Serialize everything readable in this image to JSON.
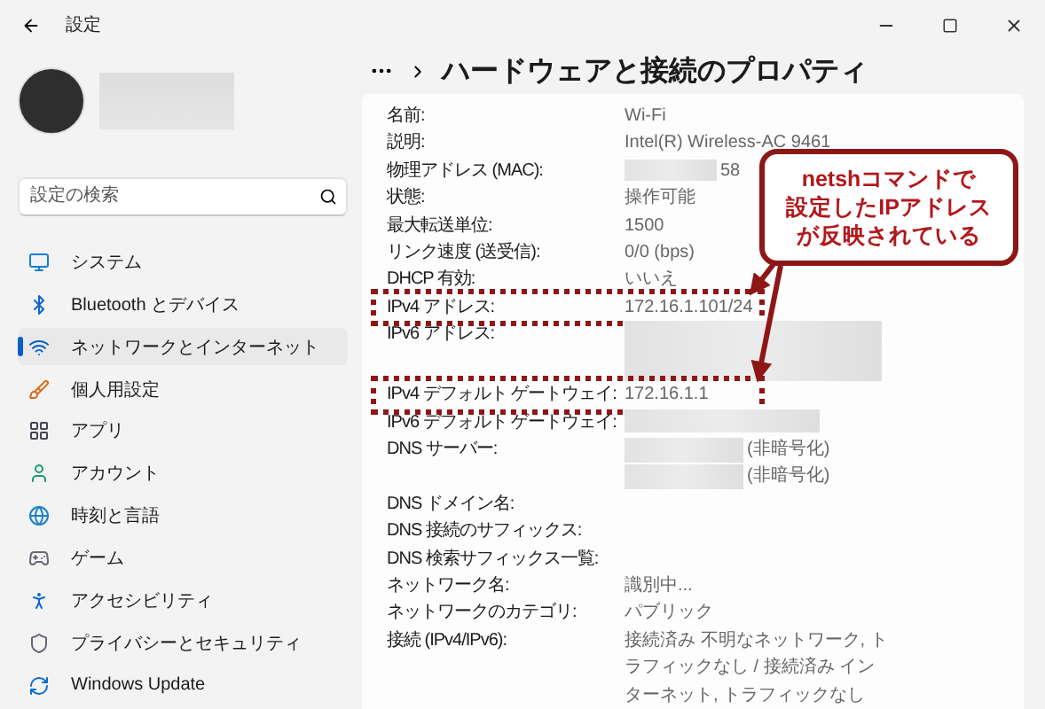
{
  "window": {
    "title": "設定"
  },
  "sidebar": {
    "search": {
      "placeholder": "設定の検索"
    },
    "items": [
      {
        "label": "システム",
        "selected": false
      },
      {
        "label": "Bluetooth とデバイス",
        "selected": false
      },
      {
        "label": "ネットワークとインターネット",
        "selected": true
      },
      {
        "label": "個人用設定",
        "selected": false
      },
      {
        "label": "アプリ",
        "selected": false
      },
      {
        "label": "アカウント",
        "selected": false
      },
      {
        "label": "時刻と言語",
        "selected": false
      },
      {
        "label": "ゲーム",
        "selected": false
      },
      {
        "label": "アクセシビリティ",
        "selected": false
      },
      {
        "label": "プライバシーとセキュリティ",
        "selected": false
      },
      {
        "label": "Windows Update",
        "selected": false
      }
    ]
  },
  "page": {
    "title": "ハードウェアと接続のプロパティ",
    "rows": [
      {
        "label": "名前:",
        "kind": "text",
        "value": "Wi-Fi",
        "highlighted": false
      },
      {
        "label": "説明:",
        "kind": "text",
        "value": "Intel(R) Wireless-AC 9461",
        "highlighted": false
      },
      {
        "label": "物理アドレス (MAC):",
        "kind": "partial",
        "value": "58",
        "highlighted": false
      },
      {
        "label": "状態:",
        "kind": "text",
        "value": "操作可能",
        "highlighted": false
      },
      {
        "label": "最大転送単位:",
        "kind": "text",
        "value": "1500",
        "highlighted": false
      },
      {
        "label": "リンク速度 (送受信):",
        "kind": "text",
        "value": "0/0 (bps)",
        "highlighted": false
      },
      {
        "label": "DHCP 有効:",
        "kind": "text",
        "value": "いいえ",
        "highlighted": false
      },
      {
        "label": "IPv4 アドレス:",
        "kind": "text",
        "value": "172.16.1.101/24",
        "highlighted": true
      },
      {
        "label": "IPv6 アドレス:",
        "kind": "redacted-tall",
        "highlighted": false
      },
      {
        "label": "IPv4 デフォルト ゲートウェイ:",
        "kind": "text",
        "value": "172.16.1.1",
        "highlighted": true
      },
      {
        "label": "IPv6 デフォルト ゲートウェイ:",
        "kind": "redacted",
        "highlighted": false
      },
      {
        "label": "DNS サーバー:",
        "kind": "dns",
        "suffixes": [
          "(非暗号化)",
          "(非暗号化)"
        ],
        "highlighted": false
      },
      {
        "label": "DNS ドメイン名:",
        "kind": "empty",
        "highlighted": false
      },
      {
        "label": "DNS 接続のサフィックス:",
        "kind": "empty",
        "highlighted": false
      },
      {
        "label": "DNS 検索サフィックス一覧:",
        "kind": "empty",
        "highlighted": false
      },
      {
        "label": "ネットワーク名:",
        "kind": "text",
        "value": "識別中...",
        "highlighted": false
      },
      {
        "label": "ネットワークのカテゴリ:",
        "kind": "text",
        "value": "パブリック",
        "highlighted": false
      },
      {
        "label": "接続 (IPv4/IPv6):",
        "kind": "text",
        "value": "接続済み 不明なネットワーク, トラフィックなし / 接続済み インターネット, トラフィックなし",
        "highlighted": false
      }
    ]
  },
  "annotation": {
    "lines": [
      "netshコマンドで",
      "設定したIPアドレス",
      "が反映されている"
    ]
  }
}
